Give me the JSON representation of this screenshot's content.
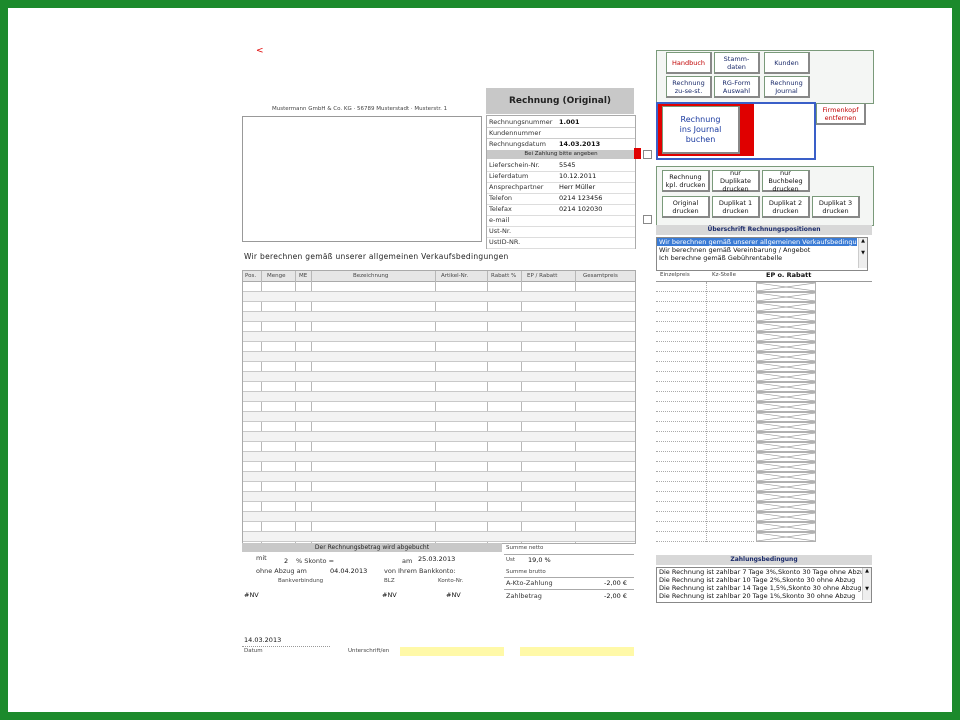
{
  "invoice": {
    "marker": "<",
    "sender_line": "Mustermann GmbH & Co. KG · 56789 Musterstadt · Musterstr. 1",
    "title": "Rechnung   (Original)",
    "fields": [
      {
        "label": "Rechnungsnummer",
        "value": "1.001"
      },
      {
        "label": "Kundennummer",
        "value": ""
      },
      {
        "label": "Rechnungsdatum",
        "value": "14.03.2013"
      }
    ],
    "payment_header": "Bei Zahlung bitte angeben",
    "info": [
      {
        "label": "Lieferschein-Nr.",
        "value": "5545"
      },
      {
        "label": "Lieferdatum",
        "value": "10.12.2011"
      },
      {
        "label": "Ansprechpartner",
        "value": "Herr Müller"
      },
      {
        "label": "Telefon",
        "value": "0214 123456"
      },
      {
        "label": "Telefax",
        "value": "0214 102030"
      },
      {
        "label": "e-mail",
        "value": ""
      },
      {
        "label": "Ust-Nr.",
        "value": ""
      },
      {
        "label": "UstID-NR.",
        "value": ""
      }
    ],
    "intro": "Wir berechnen gemäß unserer allgemeinen Verkaufsbedingungen",
    "table_headers": [
      "Pos.",
      "Menge",
      "ME",
      "Bezeichnung",
      "Artikel-Nr.",
      "Rabatt %",
      "EP / Rabatt",
      "Gesamtpreis"
    ],
    "footer_header": "Der Rechnungsbetrag wird abgebucht",
    "payment": {
      "mit": "mit",
      "skonto_pct": "2",
      "skonto_label": "% Skonto =",
      "am": "am",
      "skonto_date": "25.03.2013",
      "ohne": "ohne Abzug am",
      "ohne_date": "04.04.2013",
      "von": "von Ihrem Bankkonto:",
      "bank_headers": [
        "Bankverbindung",
        "BLZ",
        "Konto-Nr."
      ],
      "bank_values": [
        "#NV",
        "#NV",
        "#NV"
      ]
    },
    "totals": {
      "summe_netto": "Summe netto",
      "ust_label": "Ust",
      "ust_value": "19,0 %",
      "summe_brutto": "Summe brutto",
      "akonto_label": "A-Kto-Zahlung",
      "akonto_value": "-2,00 €",
      "zahlbetrag_label": "Zahlbetrag",
      "zahlbetrag_value": "-2,00 €"
    },
    "date_value": "14.03.2013",
    "date_label": "Datum",
    "signature_label": "Unterschrift/en"
  },
  "panel": {
    "nav": [
      {
        "label": "Handbuch",
        "style": "red"
      },
      {
        "label": "Stamm-\ndaten",
        "style": "blue"
      },
      {
        "label": "Kunden",
        "style": "blue"
      },
      {
        "label": "Rechnung\nzu-se-st.",
        "style": "blue"
      },
      {
        "label": "RG-Form\nAuswahl",
        "style": "blue"
      },
      {
        "label": "Rechnung\nJournal",
        "style": "blue"
      }
    ],
    "firmenkopf": "Firmenkopf\nentfernen",
    "journal_button": "Rechnung\nins Journal\nbuchen",
    "print1": [
      {
        "label": "Rechnung\nkpl. drucken"
      },
      {
        "label": "nur Duplikate\ndrucken"
      },
      {
        "label": "nur Buchbeleg\ndrucken"
      }
    ],
    "print2": [
      {
        "label": "Original\ndrucken"
      },
      {
        "label": "Duplikat 1\ndrucken"
      },
      {
        "label": "Duplikat 2\ndrucken"
      },
      {
        "label": "Duplikat 3\ndrucken"
      }
    ],
    "heading_positions": "Überschrift Rechnungspositionen",
    "positions_list": [
      "Wir berechnen gemäß unserer allgemeinen Verkaufsbedingungen",
      "Wir berechnen gemäß Vereinbarung / Angebot",
      "Ich berechne gemäß Gebührentabelle"
    ],
    "col_headers": [
      "Einzelpreis",
      "Kz-Stelle",
      "EP o. Rabatt"
    ],
    "zahlung_heading": "Zahlungsbedingung",
    "zahlung_list": [
      "Die Rechnung ist zahlbar 7 Tage  3%,Skonto 30 Tage ohne Abzug",
      "Die Rechnung ist zahlbar 10 Tage  2%,Skonto 30 ohne Abzug",
      "Die Rechnung ist zahlbar 14 Tage  1,5%,Skonto 30 ohne Abzug",
      "Die Rechnung ist zahlbar 20 Tage  1%,Skonto 30 ohne Abzug"
    ]
  },
  "colors": {
    "frame": "#1c8a2c",
    "accent_red": "#e00000",
    "selection": "#3a7bd5",
    "yellow": "#fff9a8"
  }
}
